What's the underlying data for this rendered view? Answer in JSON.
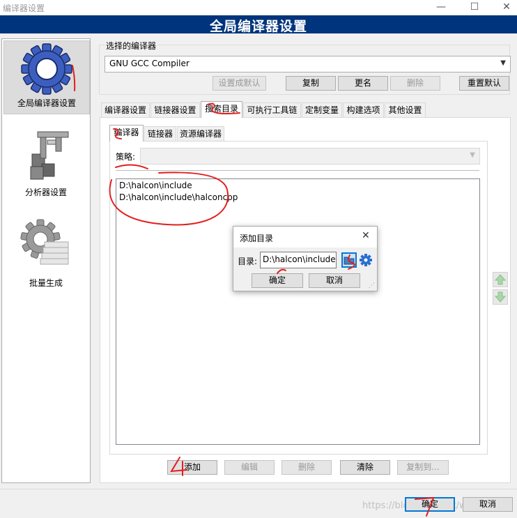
{
  "window": {
    "title": "编译器设置",
    "minimize": "—",
    "maximize": "☐",
    "close": "✕"
  },
  "banner": {
    "title": "全局编译器设置"
  },
  "sidebar": {
    "items": [
      {
        "label": "全局编译器设置",
        "icon": "gear-icon"
      },
      {
        "label": "分析器设置",
        "icon": "caliper-icon"
      },
      {
        "label": "批量生成",
        "icon": "batch-gear-icon"
      }
    ]
  },
  "compiler": {
    "group_label": "选择的编译器",
    "selected": "GNU GCC Compiler",
    "buttons": {
      "set_default": "设置成默认",
      "copy": "复制",
      "rename": "更名",
      "delete": "删除",
      "reset_defaults": "重置默认"
    }
  },
  "tabs": [
    "编译器设置",
    "链接器设置",
    "搜索目录",
    "可执行工具链",
    "定制变量",
    "构建选项",
    "其他设置"
  ],
  "subtabs": [
    "编译器",
    "链接器",
    "资源编译器"
  ],
  "policy_label": "策略:",
  "directories": [
    "D:\\halcon\\include",
    "D:\\halcon\\include\\halconcpp"
  ],
  "list_buttons": {
    "add": "添加",
    "edit": "编辑",
    "delete": "删除",
    "clear": "清除",
    "copy_to": "复制到..."
  },
  "dialog": {
    "title": "添加目录",
    "label": "目录:",
    "value": "D:\\halcon\\include",
    "ok": "确定",
    "cancel": "取消"
  },
  "footer": {
    "ok": "确定",
    "cancel": "取消"
  },
  "watermark": "https://blog.csdn.net/weixin_..."
}
